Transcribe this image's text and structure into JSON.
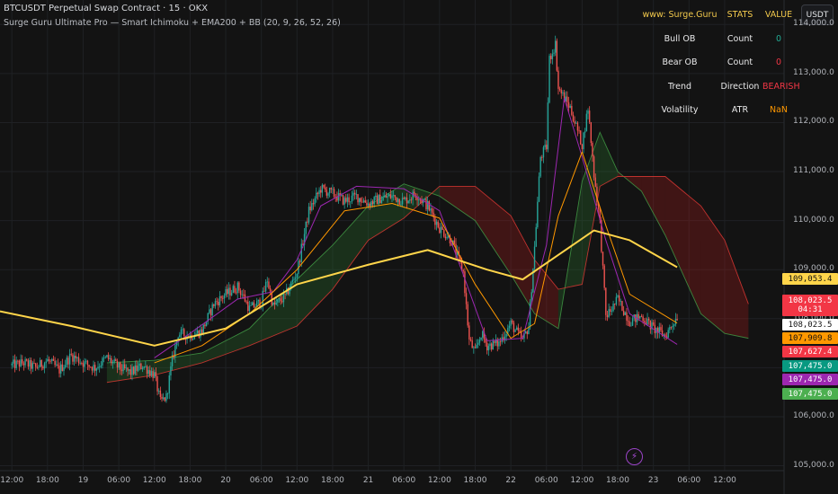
{
  "header": {
    "title": "BTCUSDT Perpetual Swap Contract · 15 · OKX",
    "indicator": "Surge Guru Ultimate Pro — Smart Ichimoku + EMA200 + BB (20, 9, 26, 52, 26)",
    "currency_button": "USDT"
  },
  "stats_table": {
    "header": [
      "www: Surge.Guru",
      "STATS",
      "VALUE"
    ],
    "rows": [
      {
        "label": "Bull OB",
        "stat": "Count",
        "value": "0",
        "color": "#22ab94"
      },
      {
        "label": "Bear OB",
        "stat": "Count",
        "value": "0",
        "color": "#f23645"
      },
      {
        "label": "Trend",
        "stat": "Direction",
        "value": "BEARISH",
        "color": "#f23645"
      },
      {
        "label": "Volatility",
        "stat": "ATR",
        "value": "NaN",
        "color": "#ff9800"
      }
    ]
  },
  "price_labels": [
    {
      "text": "109,053.4",
      "bg": "#ffd54a",
      "fg": "#111111"
    },
    {
      "text": "108,023.5",
      "sub": "04:31",
      "bg": "#f23645",
      "fg": "#ffffff"
    },
    {
      "text": "108,023.5",
      "bg": "#ffffff",
      "fg": "#111111"
    },
    {
      "text": "107,909.8",
      "bg": "#ff9800",
      "fg": "#111111"
    },
    {
      "text": "107,627.4",
      "bg": "#f23645",
      "fg": "#ffffff"
    },
    {
      "text": "107,475.0",
      "bg": "#089981",
      "fg": "#ffffff"
    },
    {
      "text": "107,475.0",
      "bg": "#9c27b0",
      "fg": "#ffffff"
    },
    {
      "text": "107,475.0",
      "bg": "#4caf50",
      "fg": "#ffffff"
    }
  ],
  "colors": {
    "background": "#131313",
    "grid": "#1f2124",
    "candle_up": "#26a69a",
    "candle_down": "#ef5350",
    "ema200": "#ffd54a",
    "bb_basis": "#ff9800",
    "conversion": "#9c27b0",
    "kumo_bull": "#2e7d32",
    "kumo_bear": "#b71c1c"
  },
  "chart_data": {
    "type": "candlestick",
    "symbol": "BTCUSDT",
    "interval": "15",
    "ylim": [
      104900,
      114500
    ],
    "y_ticks": [
      105000,
      106000,
      107000,
      108000,
      109000,
      110000,
      111000,
      112000,
      113000,
      114000
    ],
    "y_tick_labels": [
      "105,000.0",
      "106,000.0",
      "107,000.0",
      "108,000.0",
      "109,000.0",
      "110,000.0",
      "111,000.0",
      "112,000.0",
      "113,000.0",
      "114,000.0"
    ],
    "x_tick_labels": [
      "12:00",
      "18:00",
      "19",
      "06:00",
      "12:00",
      "18:00",
      "20",
      "06:00",
      "12:00",
      "18:00",
      "21",
      "06:00",
      "12:00",
      "18:00",
      "22",
      "06:00",
      "12:00",
      "18:00",
      "23",
      "06:00",
      "12:00"
    ],
    "x_range_hours": [
      -2,
      130
    ],
    "close_path": [
      [
        0,
        107050
      ],
      [
        2,
        107100
      ],
      [
        4,
        107000
      ],
      [
        6,
        107150
      ],
      [
        8,
        106950
      ],
      [
        10,
        107250
      ],
      [
        12,
        107100
      ],
      [
        14,
        107000
      ],
      [
        16,
        107200
      ],
      [
        18,
        107000
      ],
      [
        20,
        106900
      ],
      [
        22,
        107050
      ],
      [
        24,
        106850
      ],
      [
        25,
        106300
      ],
      [
        26,
        106400
      ],
      [
        27,
        107150
      ],
      [
        28,
        107700
      ],
      [
        30,
        107650
      ],
      [
        32,
        107750
      ],
      [
        34,
        108300
      ],
      [
        36,
        108500
      ],
      [
        38,
        108650
      ],
      [
        39,
        108450
      ],
      [
        40,
        108200
      ],
      [
        42,
        108350
      ],
      [
        43,
        108800
      ],
      [
        44,
        108250
      ],
      [
        46,
        108450
      ],
      [
        48,
        108950
      ],
      [
        50,
        110200
      ],
      [
        52,
        110650
      ],
      [
        54,
        110550
      ],
      [
        56,
        110400
      ],
      [
        58,
        110500
      ],
      [
        60,
        110350
      ],
      [
        62,
        110450
      ],
      [
        64,
        110500
      ],
      [
        66,
        110400
      ],
      [
        68,
        110550
      ],
      [
        70,
        110300
      ],
      [
        72,
        109850
      ],
      [
        74,
        109600
      ],
      [
        76,
        108950
      ],
      [
        77,
        107550
      ],
      [
        78,
        107300
      ],
      [
        79,
        107700
      ],
      [
        80,
        107450
      ],
      [
        82,
        107500
      ],
      [
        84,
        107900
      ],
      [
        86,
        107550
      ],
      [
        87,
        107850
      ],
      [
        88,
        109450
      ],
      [
        89,
        111300
      ],
      [
        90,
        111500
      ],
      [
        90.5,
        113300
      ],
      [
        91.5,
        113600
      ],
      [
        92,
        112700
      ],
      [
        94,
        112300
      ],
      [
        96,
        111550
      ],
      [
        97,
        112300
      ],
      [
        98,
        110950
      ],
      [
        99,
        109950
      ],
      [
        100,
        108050
      ],
      [
        101,
        108200
      ],
      [
        102,
        108400
      ],
      [
        104,
        107950
      ],
      [
        106,
        108050
      ],
      [
        108,
        107800
      ],
      [
        110,
        107650
      ],
      [
        112,
        108050
      ]
    ],
    "ema200": [
      [
        -2,
        108150
      ],
      [
        10,
        107850
      ],
      [
        24,
        107450
      ],
      [
        36,
        107800
      ],
      [
        48,
        108700
      ],
      [
        60,
        109100
      ],
      [
        70,
        109400
      ],
      [
        80,
        109000
      ],
      [
        86,
        108800
      ],
      [
        92,
        109300
      ],
      [
        98,
        109800
      ],
      [
        104,
        109600
      ],
      [
        112,
        109050
      ]
    ],
    "bb_basis": [
      [
        24,
        107100
      ],
      [
        32,
        107450
      ],
      [
        40,
        108100
      ],
      [
        48,
        109000
      ],
      [
        56,
        110200
      ],
      [
        64,
        110350
      ],
      [
        72,
        110050
      ],
      [
        78,
        108700
      ],
      [
        84,
        107600
      ],
      [
        88,
        107900
      ],
      [
        92,
        110100
      ],
      [
        96,
        111400
      ],
      [
        100,
        109900
      ],
      [
        104,
        108500
      ],
      [
        112,
        107910
      ]
    ],
    "conversion_line": [
      [
        24,
        107200
      ],
      [
        30,
        107700
      ],
      [
        38,
        108400
      ],
      [
        44,
        108550
      ],
      [
        48,
        109200
      ],
      [
        52,
        110300
      ],
      [
        58,
        110700
      ],
      [
        66,
        110650
      ],
      [
        72,
        110200
      ],
      [
        76,
        108900
      ],
      [
        80,
        107550
      ],
      [
        86,
        107600
      ],
      [
        90,
        109500
      ],
      [
        93,
        112500
      ],
      [
        96,
        111300
      ],
      [
        100,
        109600
      ],
      [
        104,
        108100
      ],
      [
        112,
        107475
      ]
    ],
    "kumo": [
      {
        "x": 16,
        "a": 107100,
        "b": 106700
      },
      {
        "x": 24,
        "a": 107150,
        "b": 106850
      },
      {
        "x": 32,
        "a": 107300,
        "b": 107100
      },
      {
        "x": 40,
        "a": 107800,
        "b": 107450
      },
      {
        "x": 48,
        "a": 108800,
        "b": 107850
      },
      {
        "x": 54,
        "a": 109500,
        "b": 108600
      },
      {
        "x": 60,
        "a": 110300,
        "b": 109600
      },
      {
        "x": 66,
        "a": 110750,
        "b": 110050
      },
      {
        "x": 72,
        "a": 110500,
        "b": 110700
      },
      {
        "x": 78,
        "a": 110000,
        "b": 110700
      },
      {
        "x": 84,
        "a": 108900,
        "b": 110100
      },
      {
        "x": 88,
        "a": 108100,
        "b": 109200
      },
      {
        "x": 92,
        "a": 107800,
        "b": 108600
      },
      {
        "x": 96,
        "a": 110800,
        "b": 108700
      },
      {
        "x": 99,
        "a": 111800,
        "b": 110700
      },
      {
        "x": 102,
        "a": 111000,
        "b": 110900
      },
      {
        "x": 106,
        "a": 110600,
        "b": 110900
      },
      {
        "x": 110,
        "a": 109700,
        "b": 110900
      },
      {
        "x": 116,
        "a": 108100,
        "b": 110300
      },
      {
        "x": 120,
        "a": 107700,
        "b": 109600
      },
      {
        "x": 124,
        "a": 107600,
        "b": 108300
      }
    ]
  }
}
